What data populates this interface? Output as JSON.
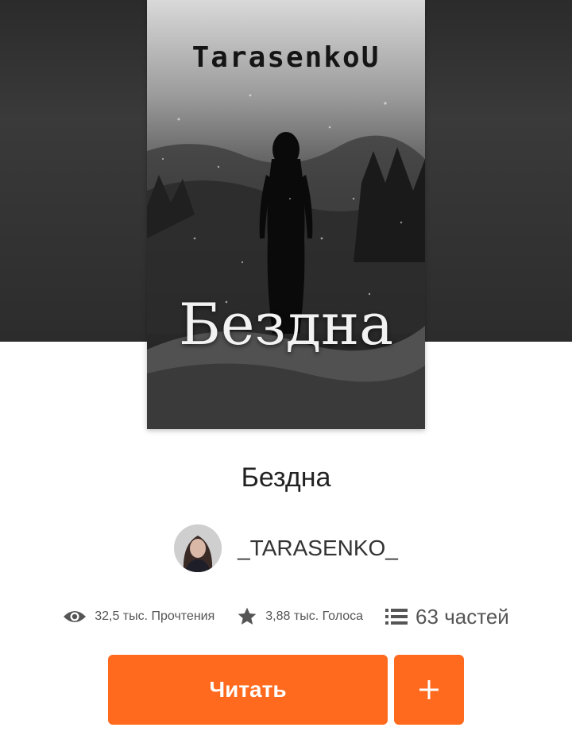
{
  "cover": {
    "author_text": "TarasenkoU",
    "title_text": "Бездна"
  },
  "book": {
    "title": "Бездна",
    "author": "_TARASENKO_"
  },
  "stats": {
    "reads": "32,5 тыс. Прочтения",
    "votes": "3,88 тыс. Голоса",
    "parts": "63 частей"
  },
  "actions": {
    "read_label": "Читать",
    "add_label": "+"
  },
  "colors": {
    "accent": "#ff6a1f",
    "backdrop": "#2f2f2f",
    "title_text": "#222222",
    "stat_text": "#555555"
  },
  "icons": {
    "reads": "eye-icon",
    "votes": "star-icon",
    "parts": "list-icon",
    "add": "plus-icon"
  }
}
